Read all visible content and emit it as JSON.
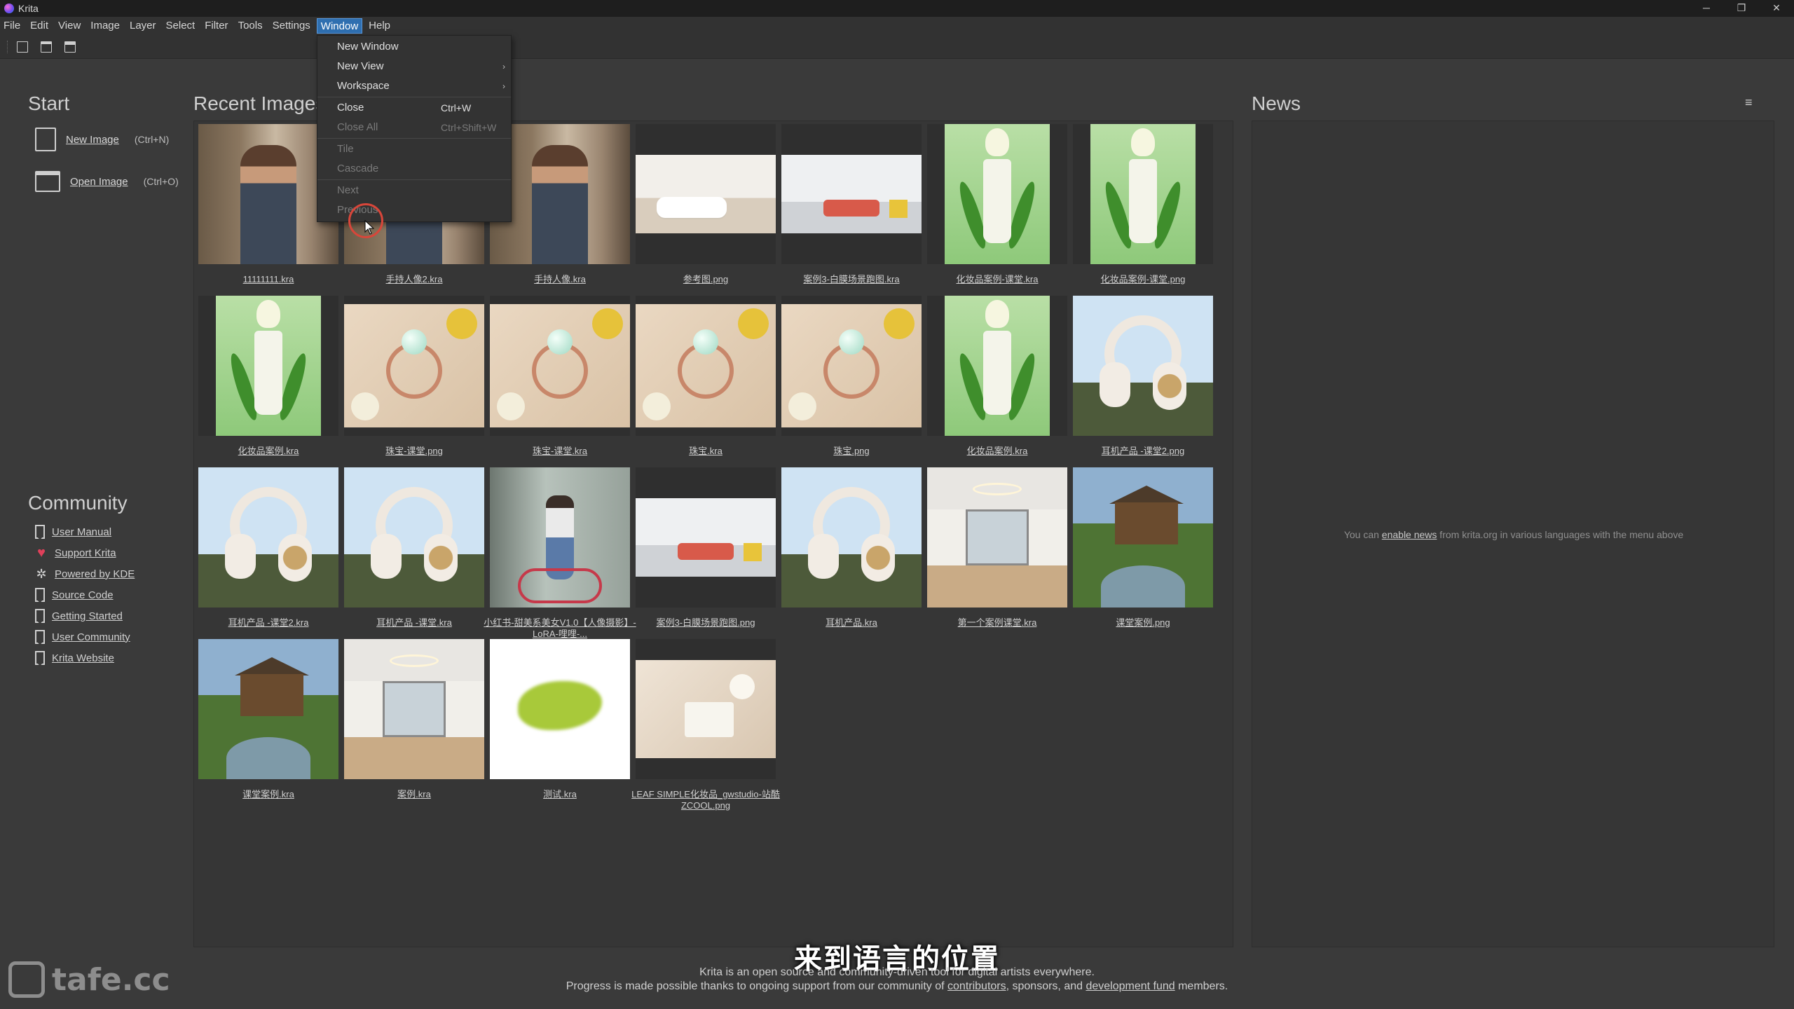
{
  "titlebar": {
    "app_title": "Krita",
    "minimize_glyph": "─",
    "maximize_glyph": "❐",
    "close_glyph": "✕"
  },
  "menubar": {
    "items": [
      "File",
      "Edit",
      "View",
      "Image",
      "Layer",
      "Select",
      "Filter",
      "Tools",
      "Settings",
      "Window",
      "Help"
    ],
    "active": "Window"
  },
  "toolbar": {
    "icons": [
      "new-document-icon",
      "open-folder-icon",
      "save-icon"
    ]
  },
  "start": {
    "title": "Start",
    "new_image": {
      "label": "New Image",
      "shortcut": "(Ctrl+N)",
      "icon": "new-document-icon"
    },
    "open_image": {
      "label": "Open Image",
      "shortcut": "(Ctrl+O)",
      "icon": "folder-icon"
    }
  },
  "community": {
    "title": "Community",
    "items": [
      {
        "label": "User Manual",
        "icon": "bookmark-icon"
      },
      {
        "label": "Support Krita",
        "icon": "heart-icon"
      },
      {
        "label": "Powered by KDE",
        "icon": "kde-icon"
      },
      {
        "label": "Source Code",
        "icon": "bookmark-icon"
      },
      {
        "label": "Getting Started",
        "icon": "bookmark-icon"
      },
      {
        "label": "User Community",
        "icon": "bookmark-icon"
      },
      {
        "label": "Krita Website",
        "icon": "bookmark-icon"
      }
    ]
  },
  "recent": {
    "title": "Recent Images",
    "files": [
      {
        "label": "11111111.kra",
        "thumb": "shop"
      },
      {
        "label": "手持人像2.kra",
        "thumb": "shop"
      },
      {
        "label": "手持人像.kra",
        "thumb": "shop"
      },
      {
        "label": "参考图.png",
        "thumb": "room"
      },
      {
        "label": "案例3-白膜场景跑图.kra",
        "thumb": "room2"
      },
      {
        "label": "化妆品案例-课堂.kra",
        "thumb": "cos"
      },
      {
        "label": "化妆品案例-课堂.png",
        "thumb": "cos"
      },
      {
        "label": "化妆品案例.kra",
        "thumb": "cos"
      },
      {
        "label": "珠宝-课堂.png",
        "thumb": "ring"
      },
      {
        "label": "珠宝-课堂.kra",
        "thumb": "ring"
      },
      {
        "label": "珠宝.kra",
        "thumb": "ring"
      },
      {
        "label": "珠宝.png",
        "thumb": "ring"
      },
      {
        "label": "化妆品案例.kra",
        "thumb": "cos"
      },
      {
        "label": "耳机产品 -课堂2.png",
        "thumb": "head"
      },
      {
        "label": "耳机产品 -课堂2.kra",
        "thumb": "head"
      },
      {
        "label": "耳机产品 -课堂.kra",
        "thumb": "head"
      },
      {
        "label": "小红书-甜美系美女V1.0【人像摄影】-LoRA-哩哩-...",
        "thumb": "girl"
      },
      {
        "label": "案例3-白膜场景跑图.png",
        "thumb": "room2"
      },
      {
        "label": "耳机产品.kra",
        "thumb": "head"
      },
      {
        "label": "第一个案例课堂.kra",
        "thumb": "interior"
      },
      {
        "label": "课堂案例.png",
        "thumb": "cabin"
      },
      {
        "label": "课堂案例.kra",
        "thumb": "cabin"
      },
      {
        "label": "案例.kra",
        "thumb": "interior"
      },
      {
        "label": "测试.kra",
        "thumb": "blob"
      },
      {
        "label": "LEAF SIMPLE化妆品_gwstudio-站酷ZCOOL.png",
        "thumb": "leaf"
      }
    ]
  },
  "window_menu": {
    "items": [
      {
        "label": "New Window",
        "shortcut": "",
        "submenu": false,
        "enabled": true
      },
      {
        "label": "New View",
        "shortcut": "",
        "submenu": true,
        "enabled": true
      },
      {
        "label": "Workspace",
        "shortcut": "",
        "submenu": true,
        "enabled": true
      },
      {
        "sep": true
      },
      {
        "label": "Close",
        "shortcut": "Ctrl+W",
        "submenu": false,
        "enabled": true
      },
      {
        "label": "Close All",
        "shortcut": "Ctrl+Shift+W",
        "submenu": false,
        "enabled": false
      },
      {
        "sep": true
      },
      {
        "label": "Tile",
        "shortcut": "",
        "submenu": false,
        "enabled": false
      },
      {
        "label": "Cascade",
        "shortcut": "",
        "submenu": false,
        "enabled": false
      },
      {
        "sep": true
      },
      {
        "label": "Next",
        "shortcut": "",
        "submenu": false,
        "enabled": false
      },
      {
        "label": "Previous",
        "shortcut": "",
        "submenu": false,
        "enabled": false
      }
    ],
    "submenu_arrow": "›"
  },
  "news": {
    "title": "News",
    "menu_icon": "≡",
    "text_before": "You can ",
    "link": "enable news",
    "text_after": " from krita.org in various languages with the menu above"
  },
  "footer": {
    "line1": "Krita is an open source and community-driven tool for digital artists everywhere.",
    "line2_before": "Progress is made possible thanks to ongoing support from our community of ",
    "link_contributors": "contributors",
    "line2_mid": ", sponsors, and ",
    "link_fund": "development fund",
    "line2_after": " members."
  },
  "overlay": {
    "subtitle": "来到语言的位置",
    "watermark": "tafe.cc"
  },
  "colors": {
    "accent_menu": "#2f6fb0",
    "heart": "#e0405a",
    "click_ring": "#d8463a"
  }
}
